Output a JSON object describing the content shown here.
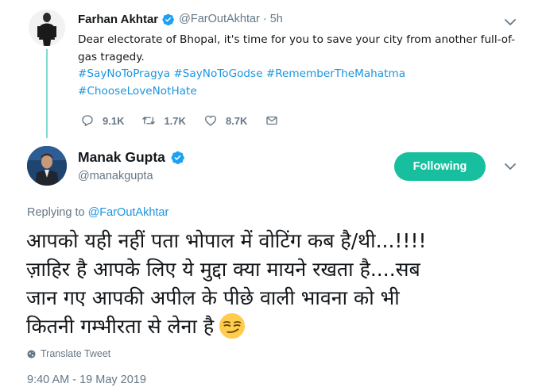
{
  "parent_tweet": {
    "author_name": "Farhan Akhtar",
    "handle": "@FarOutAkhtar",
    "separator": "·",
    "time": "5h",
    "text_lines": [
      "Dear electorate of Bhopal, it's time for you to save your city from another full-of-",
      "gas tragedy."
    ],
    "hashtag_lines": [
      "#SayNoToPragya #SayNoToGodse #RememberTheMahatma",
      "#ChooseLoveNotHate"
    ],
    "reply_count": "9.1K",
    "retweet_count": "1.7K",
    "like_count": "8.7K"
  },
  "main_tweet": {
    "author_name": "Manak Gupta",
    "handle": "@manakgupta",
    "follow_label": "Following",
    "replying_prefix": "Replying to",
    "replying_handle": "@FarOutAkhtar",
    "text_lines": [
      "आपको यही नहीं पता भोपाल में वोटिंग कब है/थी...!!!!",
      "ज़ाहिर है आपके लिए ये मुद्दा क्या मायने रखता है....सब",
      "जान गए आपकी अपील के पीछे वाली भावना को भी",
      "कितनी गम्भीरता से लेना है"
    ],
    "emoji": "smirking-face",
    "translate_label": "Translate Tweet",
    "timestamp": "9:40 AM - 19 May 2019"
  },
  "colors": {
    "link": "#1b95e0",
    "verified": "#1da1f2",
    "following_button": "#17bf9e",
    "thread_line": "#7fdbd0",
    "secondary_text": "#657786"
  }
}
